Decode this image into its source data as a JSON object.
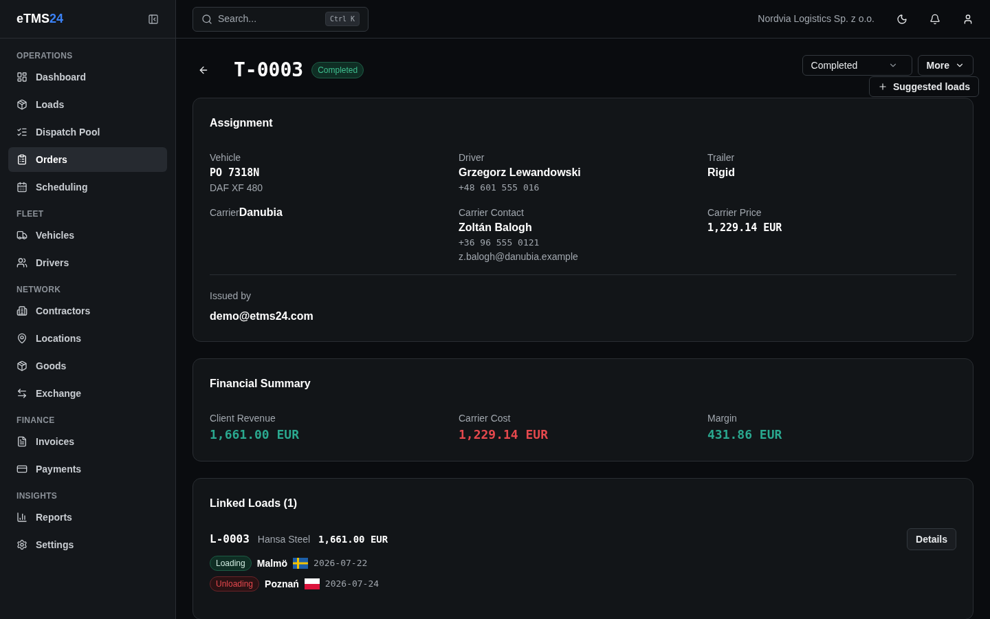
{
  "brand": {
    "name": "eTMS",
    "suffix": "24"
  },
  "search": {
    "placeholder": "Search...",
    "shortcut": "Ctrl K"
  },
  "company": "Nordvia Logistics Sp. z o.o.",
  "sidebar": {
    "sections": [
      {
        "title": "OPERATIONS",
        "items": [
          {
            "label": "Dashboard",
            "selected": false
          },
          {
            "label": "Loads",
            "selected": false
          },
          {
            "label": "Dispatch Pool",
            "selected": false
          },
          {
            "label": "Orders",
            "selected": true
          },
          {
            "label": "Scheduling",
            "selected": false
          }
        ]
      },
      {
        "title": "FLEET",
        "items": [
          {
            "label": "Vehicles",
            "selected": false
          },
          {
            "label": "Drivers",
            "selected": false
          }
        ]
      },
      {
        "title": "NETWORK",
        "items": [
          {
            "label": "Contractors",
            "selected": false
          },
          {
            "label": "Locations",
            "selected": false
          },
          {
            "label": "Goods",
            "selected": false
          },
          {
            "label": "Exchange",
            "selected": false
          }
        ]
      },
      {
        "title": "FINANCE",
        "items": [
          {
            "label": "Invoices",
            "selected": false
          },
          {
            "label": "Payments",
            "selected": false
          }
        ]
      },
      {
        "title": "INSIGHTS",
        "items": [
          {
            "label": "Reports",
            "selected": false
          },
          {
            "label": "Settings",
            "selected": false
          }
        ]
      }
    ]
  },
  "order": {
    "number": "T-0003",
    "status": "Completed",
    "status_select": "Completed",
    "more": "More",
    "suggested": "Suggested loads"
  },
  "assignment": {
    "title": "Assignment",
    "vehicle": {
      "label": "Vehicle",
      "plate": "PO 7318N",
      "model": "DAF XF 480"
    },
    "driver": {
      "label": "Driver",
      "name": "Grzegorz Lewandowski",
      "phone": "+48 601 555 016"
    },
    "trailer": {
      "label": "Trailer",
      "value": "Rigid"
    },
    "carrier": {
      "label": "Carrier",
      "value": "Danubia"
    },
    "contact": {
      "label": "Carrier Contact",
      "name": "Zoltán Balogh",
      "phone": "+36 96 555 0121",
      "email": "z.balogh@danubia.example"
    },
    "price": {
      "label": "Carrier Price",
      "value": "1,229.14 EUR"
    },
    "issued": {
      "label": "Issued by",
      "value": "demo@etms24.com"
    }
  },
  "financial": {
    "title": "Financial Summary",
    "items": [
      {
        "label": "Client Revenue",
        "value": "1,661.00 EUR",
        "color": "#2aa88f"
      },
      {
        "label": "Carrier Cost",
        "value": "1,229.14 EUR",
        "color": "#e5484d"
      },
      {
        "label": "Margin",
        "value": "431.86 EUR",
        "color": "#2aa88f"
      }
    ]
  },
  "linked": {
    "title": "Linked Loads (1)",
    "loads": [
      {
        "number": "L-0003",
        "client": "Hansa Steel",
        "amount": "1,661.00 EUR",
        "details": "Details",
        "stops": [
          {
            "kind": "loading",
            "label": "Loading",
            "city": "Malmö",
            "date": "2026-07-22"
          },
          {
            "kind": "unloading",
            "label": "Unloading",
            "city": "Poznań",
            "date": "2026-07-24"
          }
        ]
      }
    ]
  }
}
